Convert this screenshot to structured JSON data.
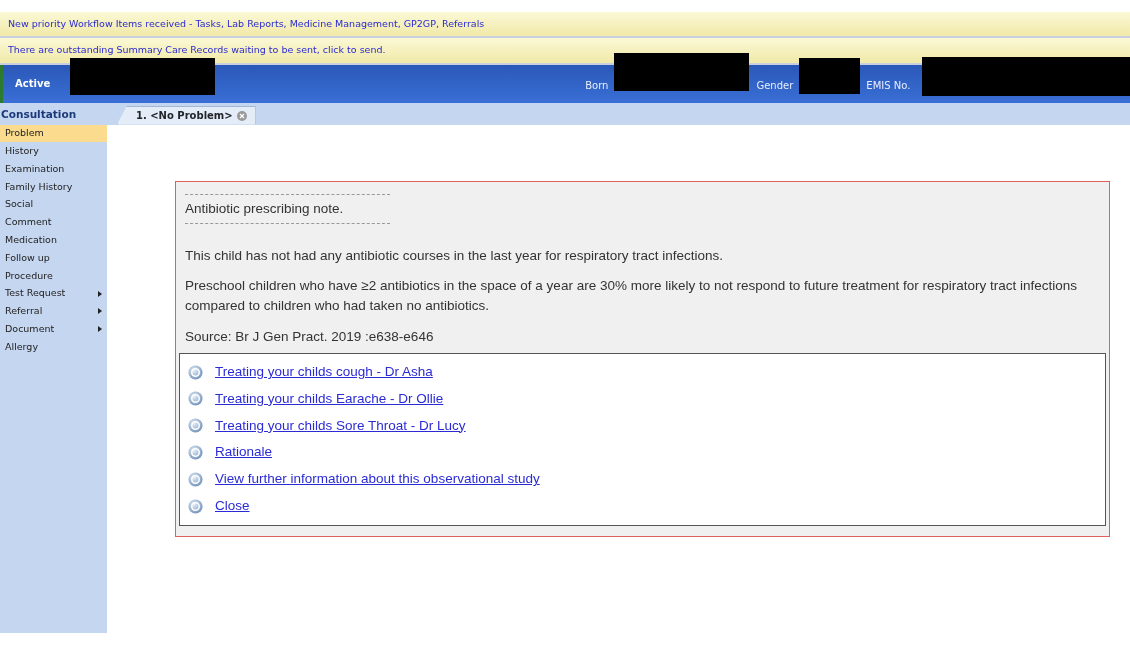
{
  "notifications": [
    {
      "text": "New priority Workflow Items received - Tasks, Lab Reports, Medicine Management, GP2GP, Referrals"
    },
    {
      "text": "There are outstanding Summary Care Records waiting to be sent, click to send."
    }
  ],
  "patient_bar": {
    "status": "Active",
    "fields": [
      {
        "label": "Born"
      },
      {
        "label": "Gender"
      },
      {
        "label": "EMIS No."
      }
    ]
  },
  "sidebar": {
    "title": "Consultation",
    "items": [
      {
        "label": "Problem",
        "selected": true,
        "has_submenu": false
      },
      {
        "label": "History",
        "selected": false,
        "has_submenu": false
      },
      {
        "label": "Examination",
        "selected": false,
        "has_submenu": false
      },
      {
        "label": "Family History",
        "selected": false,
        "has_submenu": false
      },
      {
        "label": "Social",
        "selected": false,
        "has_submenu": false
      },
      {
        "label": "Comment",
        "selected": false,
        "has_submenu": false
      },
      {
        "label": "Medication",
        "selected": false,
        "has_submenu": false
      },
      {
        "label": "Follow up",
        "selected": false,
        "has_submenu": false
      },
      {
        "label": "Procedure",
        "selected": false,
        "has_submenu": false
      },
      {
        "label": "Test Request",
        "selected": false,
        "has_submenu": true
      },
      {
        "label": "Referral",
        "selected": false,
        "has_submenu": true
      },
      {
        "label": "Document",
        "selected": false,
        "has_submenu": true
      },
      {
        "label": "Allergy",
        "selected": false,
        "has_submenu": false
      }
    ]
  },
  "tabs": [
    {
      "label": "1. <No Problem>",
      "selected": true
    }
  ],
  "note": {
    "title": "Antibiotic prescribing note.",
    "paragraphs": [
      "This child has not had any antibiotic courses in the last year for respiratory tract infections.",
      "Preschool children who have ≥2 antibiotics in the space of a year are 30% more likely to not respond to future treatment for respiratory tract infections compared to children who had taken no antibiotics.",
      "Source: Br J Gen Pract. 2019 :e638-e646"
    ],
    "links": [
      "Treating your childs cough - Dr Asha",
      "Treating your childs Earache - Dr Ollie",
      "Treating your childs Sore Throat - Dr Lucy",
      "Rationale",
      "View further information about this observational study",
      "Close"
    ]
  }
}
